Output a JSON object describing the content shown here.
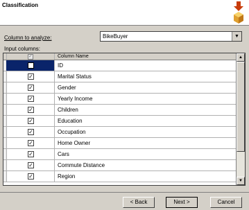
{
  "header": {
    "title": "Classification"
  },
  "form": {
    "column_label": "Column to analyze:",
    "column_value": "BikeBuyer",
    "input_label": "Input columns:"
  },
  "grid": {
    "column_header": "Column Name",
    "rows": [
      {
        "name": "ID",
        "checked": false,
        "selected": true
      },
      {
        "name": "Marital Status",
        "checked": true
      },
      {
        "name": "Gender",
        "checked": true
      },
      {
        "name": "Yearly Income",
        "checked": true
      },
      {
        "name": "Children",
        "checked": true
      },
      {
        "name": "Education",
        "checked": true
      },
      {
        "name": "Occupation",
        "checked": true
      },
      {
        "name": "Home Owner",
        "checked": true
      },
      {
        "name": "Cars",
        "checked": true
      },
      {
        "name": "Commute Distance",
        "checked": true
      },
      {
        "name": "Region",
        "checked": true
      }
    ]
  },
  "buttons": {
    "back": "< Back",
    "next": "Next >",
    "cancel": "Cancel"
  },
  "icons": {
    "wizard": "wizard-box-arrow-icon",
    "dropdown": "chevron-down-icon",
    "check": "✓"
  }
}
